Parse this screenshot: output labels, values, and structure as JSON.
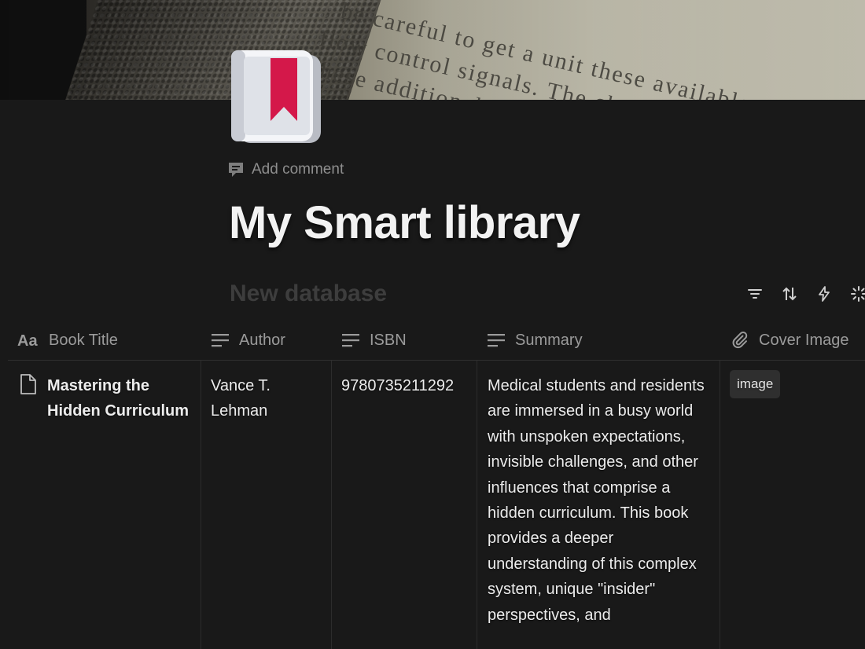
{
  "page": {
    "add_comment_label": "Add comment",
    "title": "My Smart library"
  },
  "database": {
    "title": "New database",
    "toolbar": [
      {
        "icon": "filter-icon"
      },
      {
        "icon": "sort-icon"
      },
      {
        "icon": "automation-bolt-icon"
      },
      {
        "icon": "ai-sparkle-icon"
      }
    ]
  },
  "columns": [
    {
      "label": "Book Title",
      "icon": "title-aa-icon"
    },
    {
      "label": "Author",
      "icon": "text-lines-icon"
    },
    {
      "label": "ISBN",
      "icon": "text-lines-icon"
    },
    {
      "label": "Summary",
      "icon": "text-lines-icon"
    },
    {
      "label": "Cover Image",
      "icon": "paperclip-icon"
    }
  ],
  "rows": [
    {
      "title": "Mastering the Hidden Curriculum",
      "author": "Vance T. Lehman",
      "isbn": "9780735211292",
      "summary": "Medical students and residents are immersed in a busy world with unspoken expectations, invisible challenges, and other influences that comprise a hidden curriculum. This book provides a deeper understanding of this complex system, unique \"insider\" perspectives, and",
      "cover_image": "image"
    }
  ],
  "colors": {
    "background": "#191919",
    "bookmark": "#d4184a",
    "muted_text": "#9b9b9b",
    "chip_background": "#2f2f2f"
  }
}
